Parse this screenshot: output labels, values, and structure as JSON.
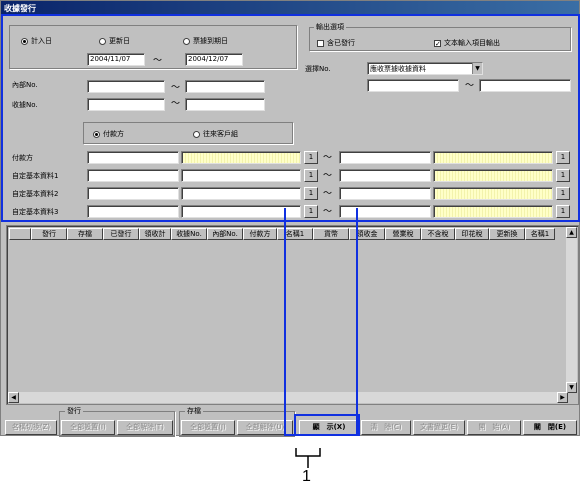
{
  "window": {
    "title": "收據發行"
  },
  "date_group": {
    "radios": [
      "計入日",
      "更新日",
      "票據到期日"
    ],
    "selected": "計入日",
    "date_from": "2004/11/07",
    "date_to": "2004/12/07",
    "tilde": "～"
  },
  "output_options": {
    "title": "輸出選項",
    "include_issued": "含已發行",
    "export_text_input": "文本輸入項目輸出",
    "include_issued_checked": false,
    "export_text_input_checked": true
  },
  "select": {
    "label": "選擇No.",
    "value": "應收票據收據資料"
  },
  "internal_no": {
    "label": "內部No."
  },
  "receipt_no": {
    "label": "收據No."
  },
  "party_radios": {
    "options": [
      "付款方",
      "往來客戶組"
    ],
    "selected": "付款方"
  },
  "rows": [
    {
      "label": "付款方"
    },
    {
      "label": "自定基本資料1"
    },
    {
      "label": "自定基本資料2"
    },
    {
      "label": "自定基本資料3"
    }
  ],
  "lookup_button": "1",
  "grid": {
    "columns": [
      "發行",
      "存檔",
      "已發行",
      "領收計",
      "收據No.",
      "內部No.",
      "付款方",
      "名稱1",
      "貨幣",
      "領收金",
      "營業稅",
      "不含稅",
      "印花稅",
      "更新換",
      "名稱1"
    ]
  },
  "footer": {
    "issue_title": "發行",
    "save_title": "存檔",
    "buttons": {
      "name_switch": "名稱切換(Z)",
      "issue_select_all": "全部設置(I)",
      "issue_clear_all": "全部解除(T)",
      "save_select_all": "全部設置(J)",
      "save_clear_all": "全部解除(U)",
      "display": "顯　示(X)",
      "delete": "清　除(C)",
      "text_change": "文書變更(E)",
      "print": "開　始(A)",
      "close": "關　閉(E)"
    }
  },
  "callout": {
    "number": "1"
  },
  "colors": {
    "highlight": "#1030e0",
    "titlebar": "#0a246a"
  }
}
